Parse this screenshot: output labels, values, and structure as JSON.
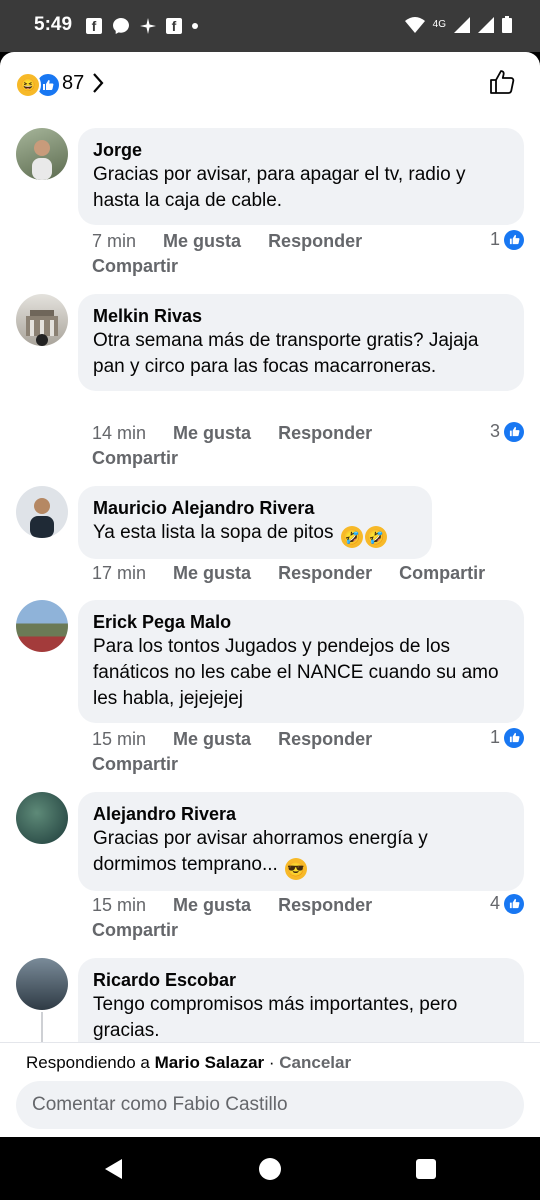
{
  "status_bar": {
    "time": "5:49",
    "network": "4G"
  },
  "reactions": {
    "count": "87"
  },
  "comments": [
    {
      "author": "Jorge",
      "text": "Gracias por avisar, para apagar el tv, radio y hasta la caja de cable.",
      "time": "7 min",
      "like": "Me gusta",
      "reply": "Responder",
      "share": "Compartir",
      "reactions": "1"
    },
    {
      "author": "Melkin Rivas",
      "text": "Otra semana más de transporte gratis? Jajaja pan y circo para las focas macarroneras.",
      "time": "14 min",
      "like": "Me gusta",
      "reply": "Responder",
      "share": "Compartir",
      "reactions": "3"
    },
    {
      "author": "Mauricio Alejandro Rivera",
      "text": "Ya esta lista la sopa de pitos",
      "time": "17 min",
      "like": "Me gusta",
      "reply": "Responder",
      "share": "Compartir"
    },
    {
      "author": "Erick Pega Malo",
      "text": "Para los tontos Jugados y pendejos  de los fanáticos no les cabe el NANCE cuando su amo les habla, jejejejej",
      "time": "15 min",
      "like": "Me gusta",
      "reply": "Responder",
      "share": "Compartir",
      "reactions": "1"
    },
    {
      "author": "Alejandro Rivera",
      "text": "Gracias por avisar ahorramos energía y dormimos temprano...",
      "time": "15 min",
      "like": "Me gusta",
      "reply": "Responder",
      "share": "Compartir",
      "reactions": "4"
    },
    {
      "author": "Ricardo Escobar",
      "text": "Tengo compromisos más importantes, pero gracias."
    }
  ],
  "reply_bar": {
    "prefix": "Respondiendo a",
    "name": "Mario Salazar",
    "separator": " · ",
    "cancel": "Cancelar"
  },
  "composer": {
    "placeholder": "Comentar como Fabio Castillo"
  }
}
